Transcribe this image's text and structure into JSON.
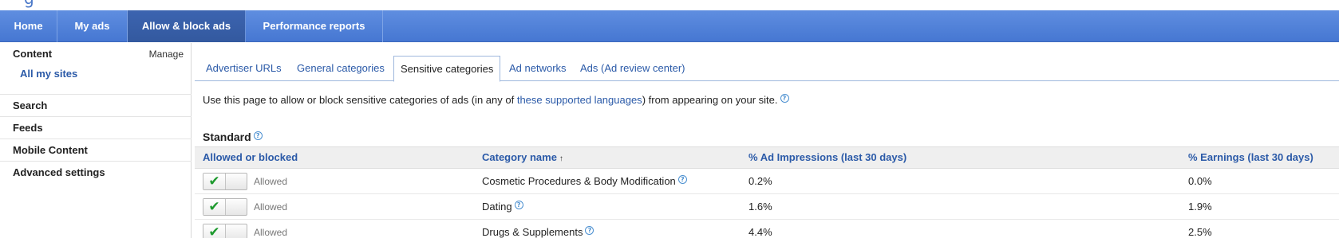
{
  "logo": {
    "glyph": "g"
  },
  "nav": {
    "tabs": [
      {
        "label": "Home"
      },
      {
        "label": "My ads"
      },
      {
        "label": "Allow & block ads",
        "active": true
      },
      {
        "label": "Performance reports"
      }
    ]
  },
  "sidebar": {
    "content_label": "Content",
    "manage_label": "Manage",
    "all_sites_label": "All my sites",
    "items": [
      {
        "label": "Search"
      },
      {
        "label": "Feeds"
      },
      {
        "label": "Mobile Content"
      },
      {
        "label": "Advanced settings"
      }
    ]
  },
  "subtabs": [
    {
      "label": "Advertiser URLs"
    },
    {
      "label": "General categories"
    },
    {
      "label": "Sensitive categories",
      "active": true
    },
    {
      "label": "Ad networks"
    },
    {
      "label": "Ads (Ad review center)"
    }
  ],
  "intro": {
    "before": "Use this page to allow or block sensitive categories of ads (in any of ",
    "link": "these supported languages",
    "after": ") from appearing on your site."
  },
  "section_title": "Standard",
  "table": {
    "headers": {
      "status": "Allowed or blocked",
      "category": "Category name",
      "sort_arrow": "↑",
      "impressions": "% Ad Impressions (last 30 days)",
      "earnings": "% Earnings (last 30 days)"
    },
    "rows": [
      {
        "status": "Allowed",
        "category": "Cosmetic Procedures & Body Modification",
        "impressions": "0.2%",
        "earnings": "0.0%"
      },
      {
        "status": "Allowed",
        "category": "Dating",
        "impressions": "1.6%",
        "earnings": "1.9%"
      },
      {
        "status": "Allowed",
        "category": "Drugs & Supplements",
        "impressions": "4.4%",
        "earnings": "2.5%"
      }
    ]
  },
  "icons": {
    "help": "?",
    "check": "✔"
  },
  "colors": {
    "nav_blue": "#4f80d8",
    "link_blue": "#2b5aa8",
    "check_green": "#1e9a2e"
  }
}
